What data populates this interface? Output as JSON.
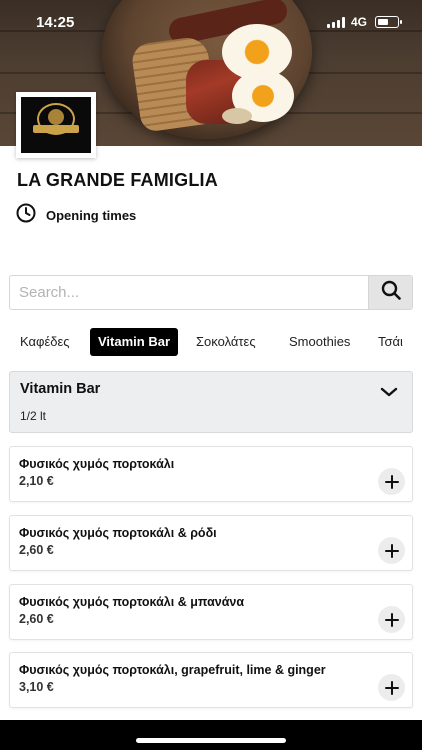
{
  "status_bar": {
    "time": "14:25",
    "network": "4G",
    "battery_level": 0.55
  },
  "venue": {
    "name": "LA GRANDE FAMIGLIA",
    "opening_times_label": "Opening times"
  },
  "icons": {
    "clock": "clock-icon",
    "search": "search-icon",
    "chevron": "chevron-down-icon",
    "add": "plus-icon"
  },
  "search": {
    "placeholder": "Search..."
  },
  "tabs": [
    {
      "label": "Καφέδες",
      "active": false
    },
    {
      "label": "Vitamin Bar",
      "active": true
    },
    {
      "label": "Σοκολάτες",
      "active": false
    },
    {
      "label": "Smoothies",
      "active": false
    },
    {
      "label": "Τσάι",
      "active": false
    }
  ],
  "section": {
    "title": "Vitamin Bar",
    "subtitle": "1/2 lt"
  },
  "items": [
    {
      "name": "Φυσικός χυμός πορτοκάλι",
      "price": "2,10 €"
    },
    {
      "name": "Φυσικός χυμός πορτοκάλι & ρόδι",
      "price": "2,60 €"
    },
    {
      "name": "Φυσικός χυμός πορτοκάλι & μπανάνα",
      "price": "2,60 €"
    },
    {
      "name": "Φυσικός χυμός πορτοκάλι, grapefruit, lime & ginger",
      "price": "3,10 €"
    }
  ],
  "colors": {
    "accent": "#000000",
    "section_bg": "#eceeef",
    "add_button_bg": "#ececec"
  }
}
